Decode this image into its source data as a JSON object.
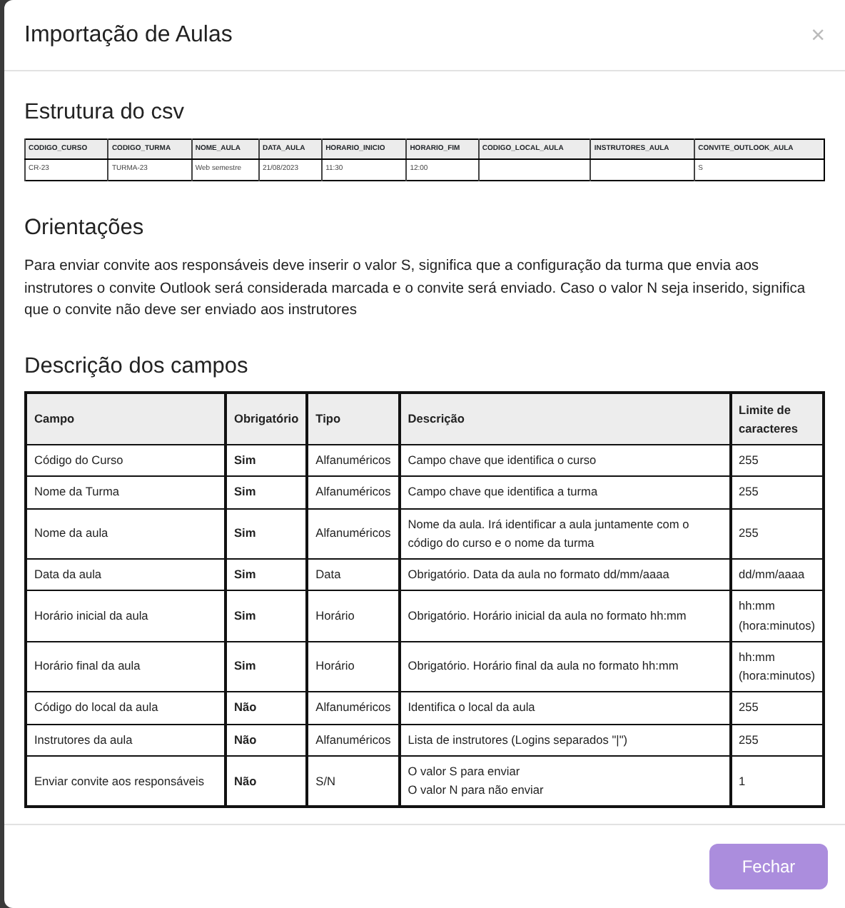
{
  "modal": {
    "title": "Importação de Aulas",
    "close": "×"
  },
  "csv": {
    "heading": "Estrutura do csv",
    "columns": [
      {
        "header": "CODIGO_CURSO",
        "value": "CR-23"
      },
      {
        "header": "CODIGO_TURMA",
        "value": "TURMA-23"
      },
      {
        "header": "NOME_AULA",
        "value": "Web semestre"
      },
      {
        "header": "DATA_AULA",
        "value": "21/08/2023"
      },
      {
        "header": "HORARIO_INICIO",
        "value": "11:30"
      },
      {
        "header": "HORARIO_FIM",
        "value": "12:00"
      },
      {
        "header": "CODIGO_LOCAL_AULA"
      },
      {
        "header": "INSTRUTORES_AULA"
      },
      {
        "header": "CONVITE_OUTLOOK_AULA",
        "value": "S"
      }
    ]
  },
  "guidance": {
    "heading": "Orientações",
    "text": "Para enviar convite aos responsáveis deve inserir o valor S, significa que a configuração da turma que envia aos instrutores o convite Outlook será considerada marcada e o convite será enviado. Caso o valor N seja inserido, significa que o convite não deve ser enviado aos instrutores"
  },
  "fields": {
    "heading": "Descrição dos campos",
    "columns": [
      "Campo",
      "Obrigatório",
      "Tipo",
      "Descrição",
      "Limite de caracteres"
    ],
    "rows": [
      [
        "Código do Curso",
        "Sim",
        "Alfanuméricos",
        "Campo chave que identifica o curso",
        "255"
      ],
      [
        "Nome da Turma",
        "Sim",
        "Alfanuméricos",
        "Campo chave que identifica a turma",
        "255"
      ],
      [
        "Nome da aula",
        "Sim",
        "Alfanuméricos",
        "Nome da aula. Irá identificar a aula juntamente com o código do curso e o nome da turma",
        "255"
      ],
      [
        "Data da aula",
        "Sim",
        "Data",
        "Obrigatório. Data da aula no formato dd/mm/aaaa",
        "dd/mm/aaaa"
      ],
      [
        "Horário inicial da aula",
        "Sim",
        "Horário",
        "Obrigatório. Horário inicial da aula no formato hh:mm",
        "hh:mm (hora:minutos)"
      ],
      [
        "Horário final da aula",
        "Sim",
        "Horário",
        "Obrigatório. Horário final da aula no formato hh:mm",
        "hh:mm (hora:minutos)"
      ],
      [
        "Código do local da aula",
        "Não",
        "Alfanuméricos",
        "Identifica o local da aula",
        "255"
      ],
      [
        "Instrutores da aula",
        "Não",
        "Alfanuméricos",
        "Lista de instrutores (Logins separados \"|\")",
        "255"
      ],
      [
        "Enviar convite aos responsáveis",
        "Não",
        "S/N",
        "O valor S para enviar\nO valor N para não enviar",
        "1"
      ]
    ]
  },
  "footer": {
    "button": "Fechar"
  }
}
